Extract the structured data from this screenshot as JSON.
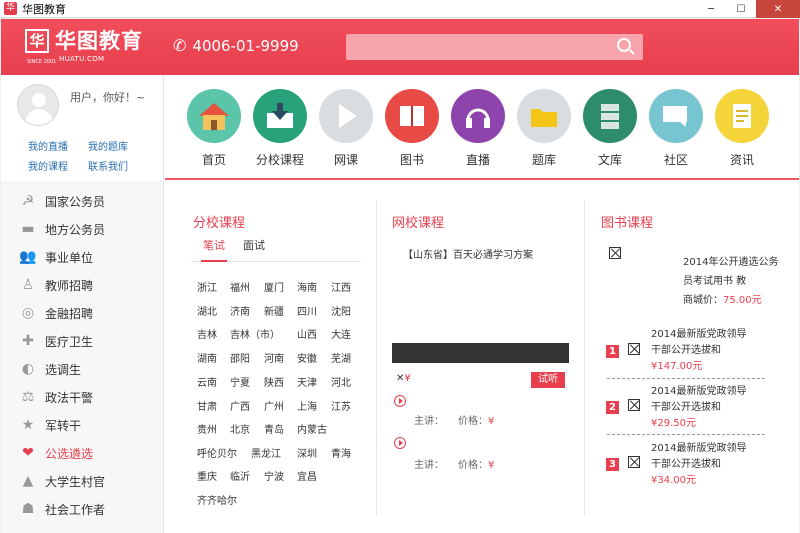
{
  "window": {
    "title": "华图教育"
  },
  "header": {
    "logo_text": "华图教育",
    "logo_sub": "HUATU.COM",
    "logo_since": "SINCE 2001",
    "phone": "4006-01-9999",
    "search_placeholder": ""
  },
  "user": {
    "greeting": "用户，你好！~",
    "links": [
      "我的直播",
      "我的题库",
      "我的课程",
      "联系我们"
    ]
  },
  "nav": [
    {
      "label": "首页",
      "icon": "home-icon",
      "color": "#5ac5a8"
    },
    {
      "label": "分校课程",
      "icon": "download-monitor-icon",
      "color": "#27a27a"
    },
    {
      "label": "网课",
      "icon": "play-icon",
      "color": "#d9dde0"
    },
    {
      "label": "图书",
      "icon": "book-icon",
      "color": "#e84a45"
    },
    {
      "label": "直播",
      "icon": "headphones-icon",
      "color": "#8e44ad"
    },
    {
      "label": "题库",
      "icon": "folder-icon",
      "color": "#d9dde0"
    },
    {
      "label": "文库",
      "icon": "database-icon",
      "color": "#2c8c6c"
    },
    {
      "label": "社区",
      "icon": "chat-icon",
      "color": "#76c5d0"
    },
    {
      "label": "资讯",
      "icon": "note-icon",
      "color": "#f5d43a"
    }
  ],
  "sidebar": [
    {
      "label": "国家公务员",
      "icon": "emblem-icon"
    },
    {
      "label": "地方公务员",
      "icon": "hat-icon"
    },
    {
      "label": "事业单位",
      "icon": "people-icon"
    },
    {
      "label": "教师招聘",
      "icon": "teacher-icon"
    },
    {
      "label": "金融招聘",
      "icon": "coin-icon"
    },
    {
      "label": "医疗卫生",
      "icon": "cross-icon"
    },
    {
      "label": "选调生",
      "icon": "circle-icon"
    },
    {
      "label": "政法干警",
      "icon": "scales-icon"
    },
    {
      "label": "军转干",
      "icon": "star-icon"
    },
    {
      "label": "公选遴选",
      "icon": "heart-icon",
      "active": true
    },
    {
      "label": "大学生村官",
      "icon": "mountain-icon"
    },
    {
      "label": "社会工作者",
      "icon": "group-icon"
    }
  ],
  "branch": {
    "title": "分校课程",
    "tabs": [
      "笔试",
      "面试"
    ],
    "cities": [
      [
        "浙江",
        "福州",
        "厦门",
        "海南",
        "江西"
      ],
      [
        "湖北",
        "济南",
        "新疆",
        "四川",
        "沈阳"
      ],
      [
        "吉林",
        "吉林（市）",
        "山西",
        "大连"
      ],
      [
        "湖南",
        "邵阳",
        "河南",
        "安徽",
        "芜湖"
      ],
      [
        "云南",
        "宁夏",
        "陕西",
        "天津",
        "河北"
      ],
      [
        "甘肃",
        "广西",
        "广州",
        "上海",
        "江苏"
      ],
      [
        "贵州",
        "北京",
        "青岛",
        "内蒙古"
      ],
      [
        "呼伦贝尔",
        "黑龙江",
        "深圳",
        "青海"
      ],
      [
        "重庆",
        "临沂",
        "宁波",
        "宜昌"
      ],
      [
        "齐齐哈尔"
      ]
    ]
  },
  "online": {
    "title": "网校课程",
    "headline": "【山东省】百天必通学习方案",
    "price_mark": "¥",
    "listen_label": "试听",
    "lecturer_label": "主讲：",
    "price_label": "价格：",
    "currency": "¥"
  },
  "books": {
    "title": "图书课程",
    "featured_title": "2014年公开遴选公务员考试用书 教",
    "featured_price_label": "商城价：",
    "featured_price": "75.00元",
    "items": [
      {
        "rank": "1",
        "line1": "2014最新版党政领导",
        "line2": "干部公开选拔和",
        "price": "¥147.00元"
      },
      {
        "rank": "2",
        "line1": "2014最新版党政领导",
        "line2": "干部公开选拔和",
        "price": "¥29.50元"
      },
      {
        "rank": "3",
        "line1": "2014最新版党政领导",
        "line2": "干部公开选拔和",
        "price": "¥34.00元"
      }
    ]
  }
}
